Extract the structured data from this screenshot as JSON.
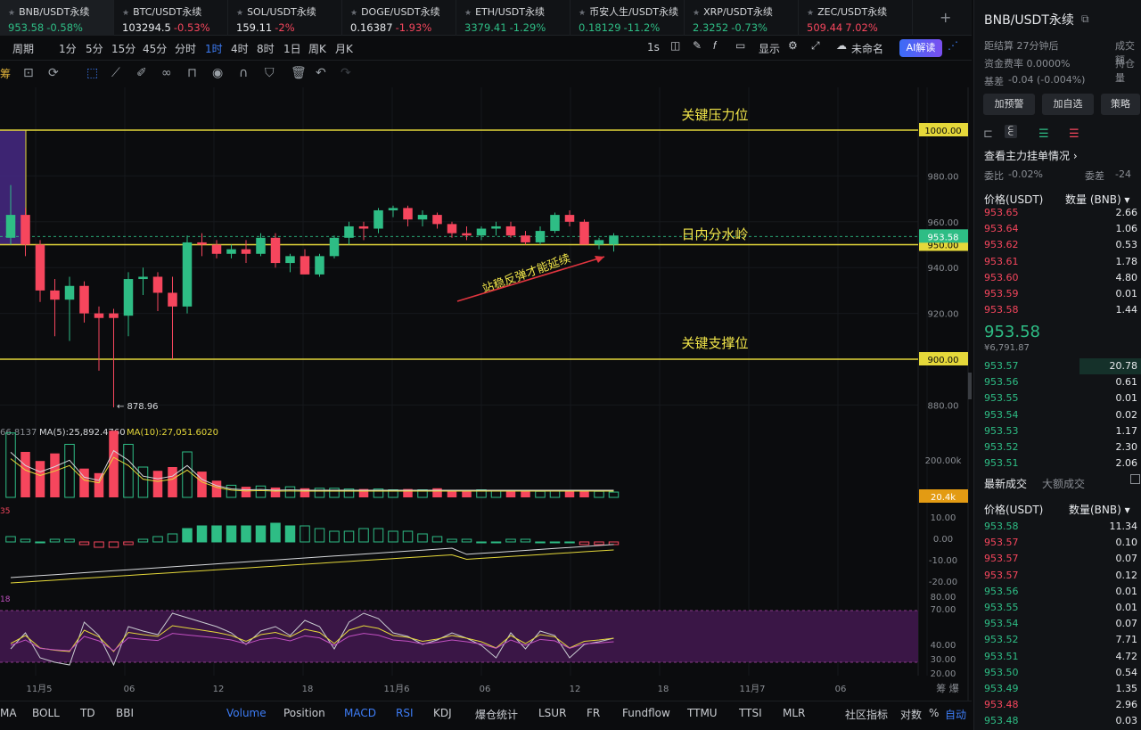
{
  "tabs": [
    {
      "name": "BNB/USDT永续",
      "price": "953.58",
      "change": "-0.58%",
      "pdir": "up",
      "cdir": "up"
    },
    {
      "name": "BTC/USDT永续",
      "price": "103294.5",
      "change": "-0.53%",
      "pdir": "",
      "cdir": "down"
    },
    {
      "name": "SOL/USDT永续",
      "price": "159.11",
      "change": "-2%",
      "pdir": "",
      "cdir": "down"
    },
    {
      "name": "DOGE/USDT永续",
      "price": "0.16387",
      "change": "-1.93%",
      "pdir": "",
      "cdir": "down"
    },
    {
      "name": "ETH/USDT永续",
      "price": "3379.41",
      "change": "-1.29%",
      "pdir": "up",
      "cdir": "up"
    },
    {
      "name": "币安人生/USDT永续",
      "price": "0.18129",
      "change": "-11.2%",
      "pdir": "up",
      "cdir": "up"
    },
    {
      "name": "XRP/USDT永续",
      "price": "2.3252",
      "change": "-0.73%",
      "pdir": "up",
      "cdir": "up"
    },
    {
      "name": "ZEC/USDT永续",
      "price": "509.44",
      "change": "7.02%",
      "pdir": "down",
      "cdir": "down"
    }
  ],
  "timeframes": [
    "周期",
    "1分",
    "5分",
    "15分",
    "45分",
    "分时",
    "1时",
    "4时",
    "8时",
    "1日",
    "周K",
    "月K"
  ],
  "active_timeframe": "1时",
  "toolbar_right": {
    "interval": "1s",
    "display": "显示",
    "layout": "未命名",
    "ai": "AI解读"
  },
  "annotations": {
    "resistance": "关键压力位",
    "pivot": "日内分水岭",
    "support": "关键支撑位",
    "arrow_text": "站稳反弹才能延续",
    "low_label": "← 878.96"
  },
  "price_axis": {
    "ticks": [
      "980.00",
      "960.00",
      "940.00",
      "920.00",
      "880.00"
    ],
    "level_labels": {
      "resistance": "1000.00",
      "pivot": "950.00",
      "support": "900.00",
      "current": "953.58"
    }
  },
  "volume_axis": {
    "ticks": [
      "200.00k"
    ],
    "current": "20.4k"
  },
  "macd_axis": {
    "ticks": [
      "10.00",
      "0.00",
      "-10.00",
      "-20.00"
    ]
  },
  "kdj_axis": {
    "ticks": [
      "80.00",
      "70.00",
      "40.00",
      "30.00",
      "20.00"
    ]
  },
  "ma_legend": {
    "prefix": "66.8137",
    "ma5": "MA(5):25,892.4760",
    "ma10": "MA(10):27,051.6020"
  },
  "volume_left_label": "35",
  "kdj_left_label": "18",
  "time_axis": [
    "11月5",
    "06",
    "12",
    "18",
    "11月6",
    "06",
    "12",
    "18",
    "11月7",
    "06"
  ],
  "time_axis_right": "筹  爆",
  "bottom_indicators": [
    "MA",
    "BOLL",
    "TD",
    "BBI",
    "Volume",
    "Position",
    "MACD",
    "RSI",
    "KDJ",
    "爆仓统计",
    "LSUR",
    "FR",
    "Fundflow",
    "TTMU",
    "TTSI",
    "MLR"
  ],
  "active_indicators": [
    "Volume",
    "MACD",
    "RSI"
  ],
  "bottom_right": {
    "community": "社区指标",
    "log": "对数",
    "pct": "%",
    "auto": "自动"
  },
  "chart_data": {
    "type": "candlestick",
    "series": [
      {
        "o": 953,
        "h": 976,
        "l": 950,
        "c": 963
      },
      {
        "o": 963,
        "h": 966,
        "l": 945,
        "c": 950
      },
      {
        "o": 950,
        "h": 952,
        "l": 925,
        "c": 930
      },
      {
        "o": 930,
        "h": 935,
        "l": 910,
        "c": 926
      },
      {
        "o": 926,
        "h": 936,
        "l": 908,
        "c": 932
      },
      {
        "o": 932,
        "h": 934,
        "l": 916,
        "c": 920
      },
      {
        "o": 920,
        "h": 923,
        "l": 895,
        "c": 918
      },
      {
        "o": 920,
        "h": 922,
        "l": 879,
        "c": 918
      },
      {
        "o": 919,
        "h": 938,
        "l": 910,
        "c": 935
      },
      {
        "o": 935,
        "h": 940,
        "l": 928,
        "c": 936
      },
      {
        "o": 936,
        "h": 938,
        "l": 921,
        "c": 929
      },
      {
        "o": 929,
        "h": 936,
        "l": 900,
        "c": 923
      },
      {
        "o": 923,
        "h": 954,
        "l": 920,
        "c": 951
      },
      {
        "o": 951,
        "h": 955,
        "l": 945,
        "c": 950
      },
      {
        "o": 950,
        "h": 952,
        "l": 944,
        "c": 946
      },
      {
        "o": 946,
        "h": 950,
        "l": 944,
        "c": 948
      },
      {
        "o": 948,
        "h": 952,
        "l": 942,
        "c": 946
      },
      {
        "o": 946,
        "h": 955,
        "l": 945,
        "c": 953
      },
      {
        "o": 953,
        "h": 955,
        "l": 940,
        "c": 942
      },
      {
        "o": 942,
        "h": 946,
        "l": 938,
        "c": 945
      },
      {
        "o": 945,
        "h": 948,
        "l": 937,
        "c": 937
      },
      {
        "o": 937,
        "h": 946,
        "l": 936,
        "c": 945
      },
      {
        "o": 945,
        "h": 954,
        "l": 944,
        "c": 953
      },
      {
        "o": 953,
        "h": 960,
        "l": 950,
        "c": 958
      },
      {
        "o": 958,
        "h": 960,
        "l": 952,
        "c": 957
      },
      {
        "o": 957,
        "h": 966,
        "l": 955,
        "c": 965
      },
      {
        "o": 965,
        "h": 967,
        "l": 962,
        "c": 966
      },
      {
        "o": 966,
        "h": 967,
        "l": 958,
        "c": 961
      },
      {
        "o": 961,
        "h": 965,
        "l": 958,
        "c": 963
      },
      {
        "o": 963,
        "h": 964,
        "l": 957,
        "c": 959
      },
      {
        "o": 959,
        "h": 960,
        "l": 953,
        "c": 955
      },
      {
        "o": 955,
        "h": 958,
        "l": 952,
        "c": 954
      },
      {
        "o": 954,
        "h": 958,
        "l": 952,
        "c": 957
      },
      {
        "o": 957,
        "h": 960,
        "l": 954,
        "c": 958
      },
      {
        "o": 958,
        "h": 960,
        "l": 953,
        "c": 954
      },
      {
        "o": 954,
        "h": 956,
        "l": 950,
        "c": 951
      },
      {
        "o": 951,
        "h": 958,
        "l": 950,
        "c": 956
      },
      {
        "o": 956,
        "h": 964,
        "l": 955,
        "c": 963
      },
      {
        "o": 963,
        "h": 965,
        "l": 958,
        "c": 960
      },
      {
        "o": 960,
        "h": 961,
        "l": 950,
        "c": 950
      },
      {
        "o": 950,
        "h": 953,
        "l": 948,
        "c": 952
      },
      {
        "o": 950,
        "h": 955,
        "l": 947,
        "c": 954
      }
    ],
    "volume": [
      85,
      60,
      48,
      58,
      70,
      38,
      32,
      88,
      70,
      40,
      35,
      40,
      60,
      34,
      22,
      16,
      14,
      15,
      13,
      14,
      12,
      12,
      12,
      11,
      11,
      11,
      10,
      11,
      10,
      12,
      10,
      9,
      10,
      9,
      9,
      9,
      8,
      9,
      8,
      8,
      8,
      7
    ],
    "macd_hist": [
      2,
      1,
      0,
      1,
      1,
      -1,
      -2,
      -2,
      -1,
      1,
      2,
      3,
      5,
      6,
      6,
      6,
      6,
      6,
      7,
      6,
      6,
      5,
      4,
      4,
      5,
      5,
      4,
      4,
      3,
      2,
      1,
      1,
      0,
      0,
      1,
      1,
      0,
      0,
      0,
      -1,
      -1,
      -1
    ],
    "ylim": [
      870,
      1010
    ]
  }
}
